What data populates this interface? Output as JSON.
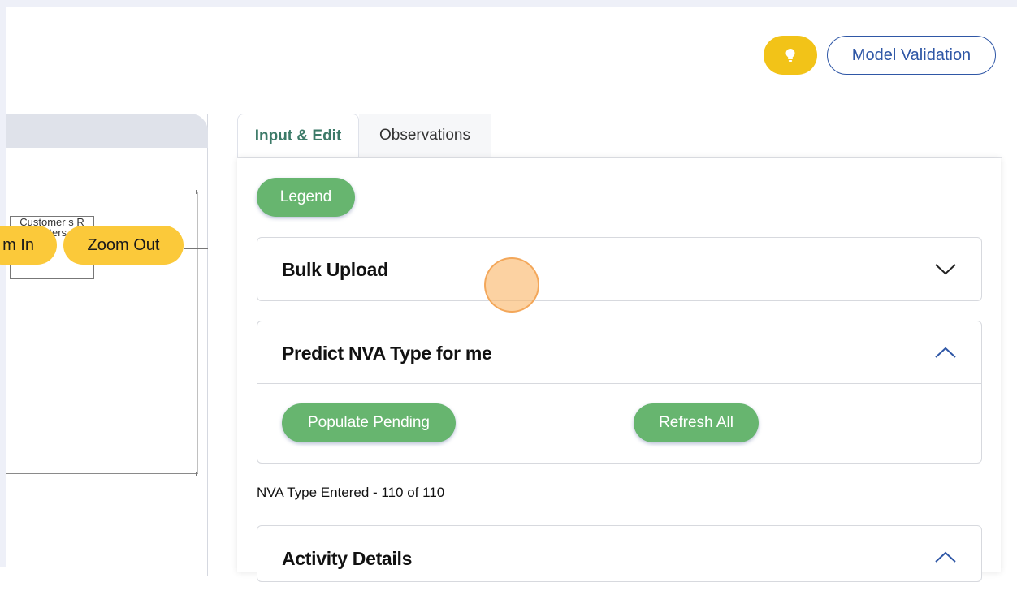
{
  "header": {
    "hint_icon": "lightbulb-icon",
    "model_validation_label": "Model Validation"
  },
  "canvas": {
    "zoom_in_label": "m In",
    "zoom_out_label": "Zoom Out",
    "node_text": "Customer s R enters"
  },
  "tabs": [
    {
      "label": "Input & Edit",
      "active": true
    },
    {
      "label": "Observations",
      "active": false
    }
  ],
  "panel": {
    "legend_label": "Legend",
    "bulk_upload_title": "Bulk Upload",
    "predict_title": "Predict NVA Type for me",
    "populate_pending_label": "Populate Pending",
    "refresh_all_label": "Refresh All",
    "nva_status": "NVA Type Entered - 110 of 110",
    "activity_details_title": "Activity Details"
  },
  "colors": {
    "accent_blue": "#2f57a6",
    "green": "#67b56f",
    "yellow": "#f2c318",
    "zoom_yellow": "#fbc93a",
    "tab_active_text": "#3c7a68"
  }
}
